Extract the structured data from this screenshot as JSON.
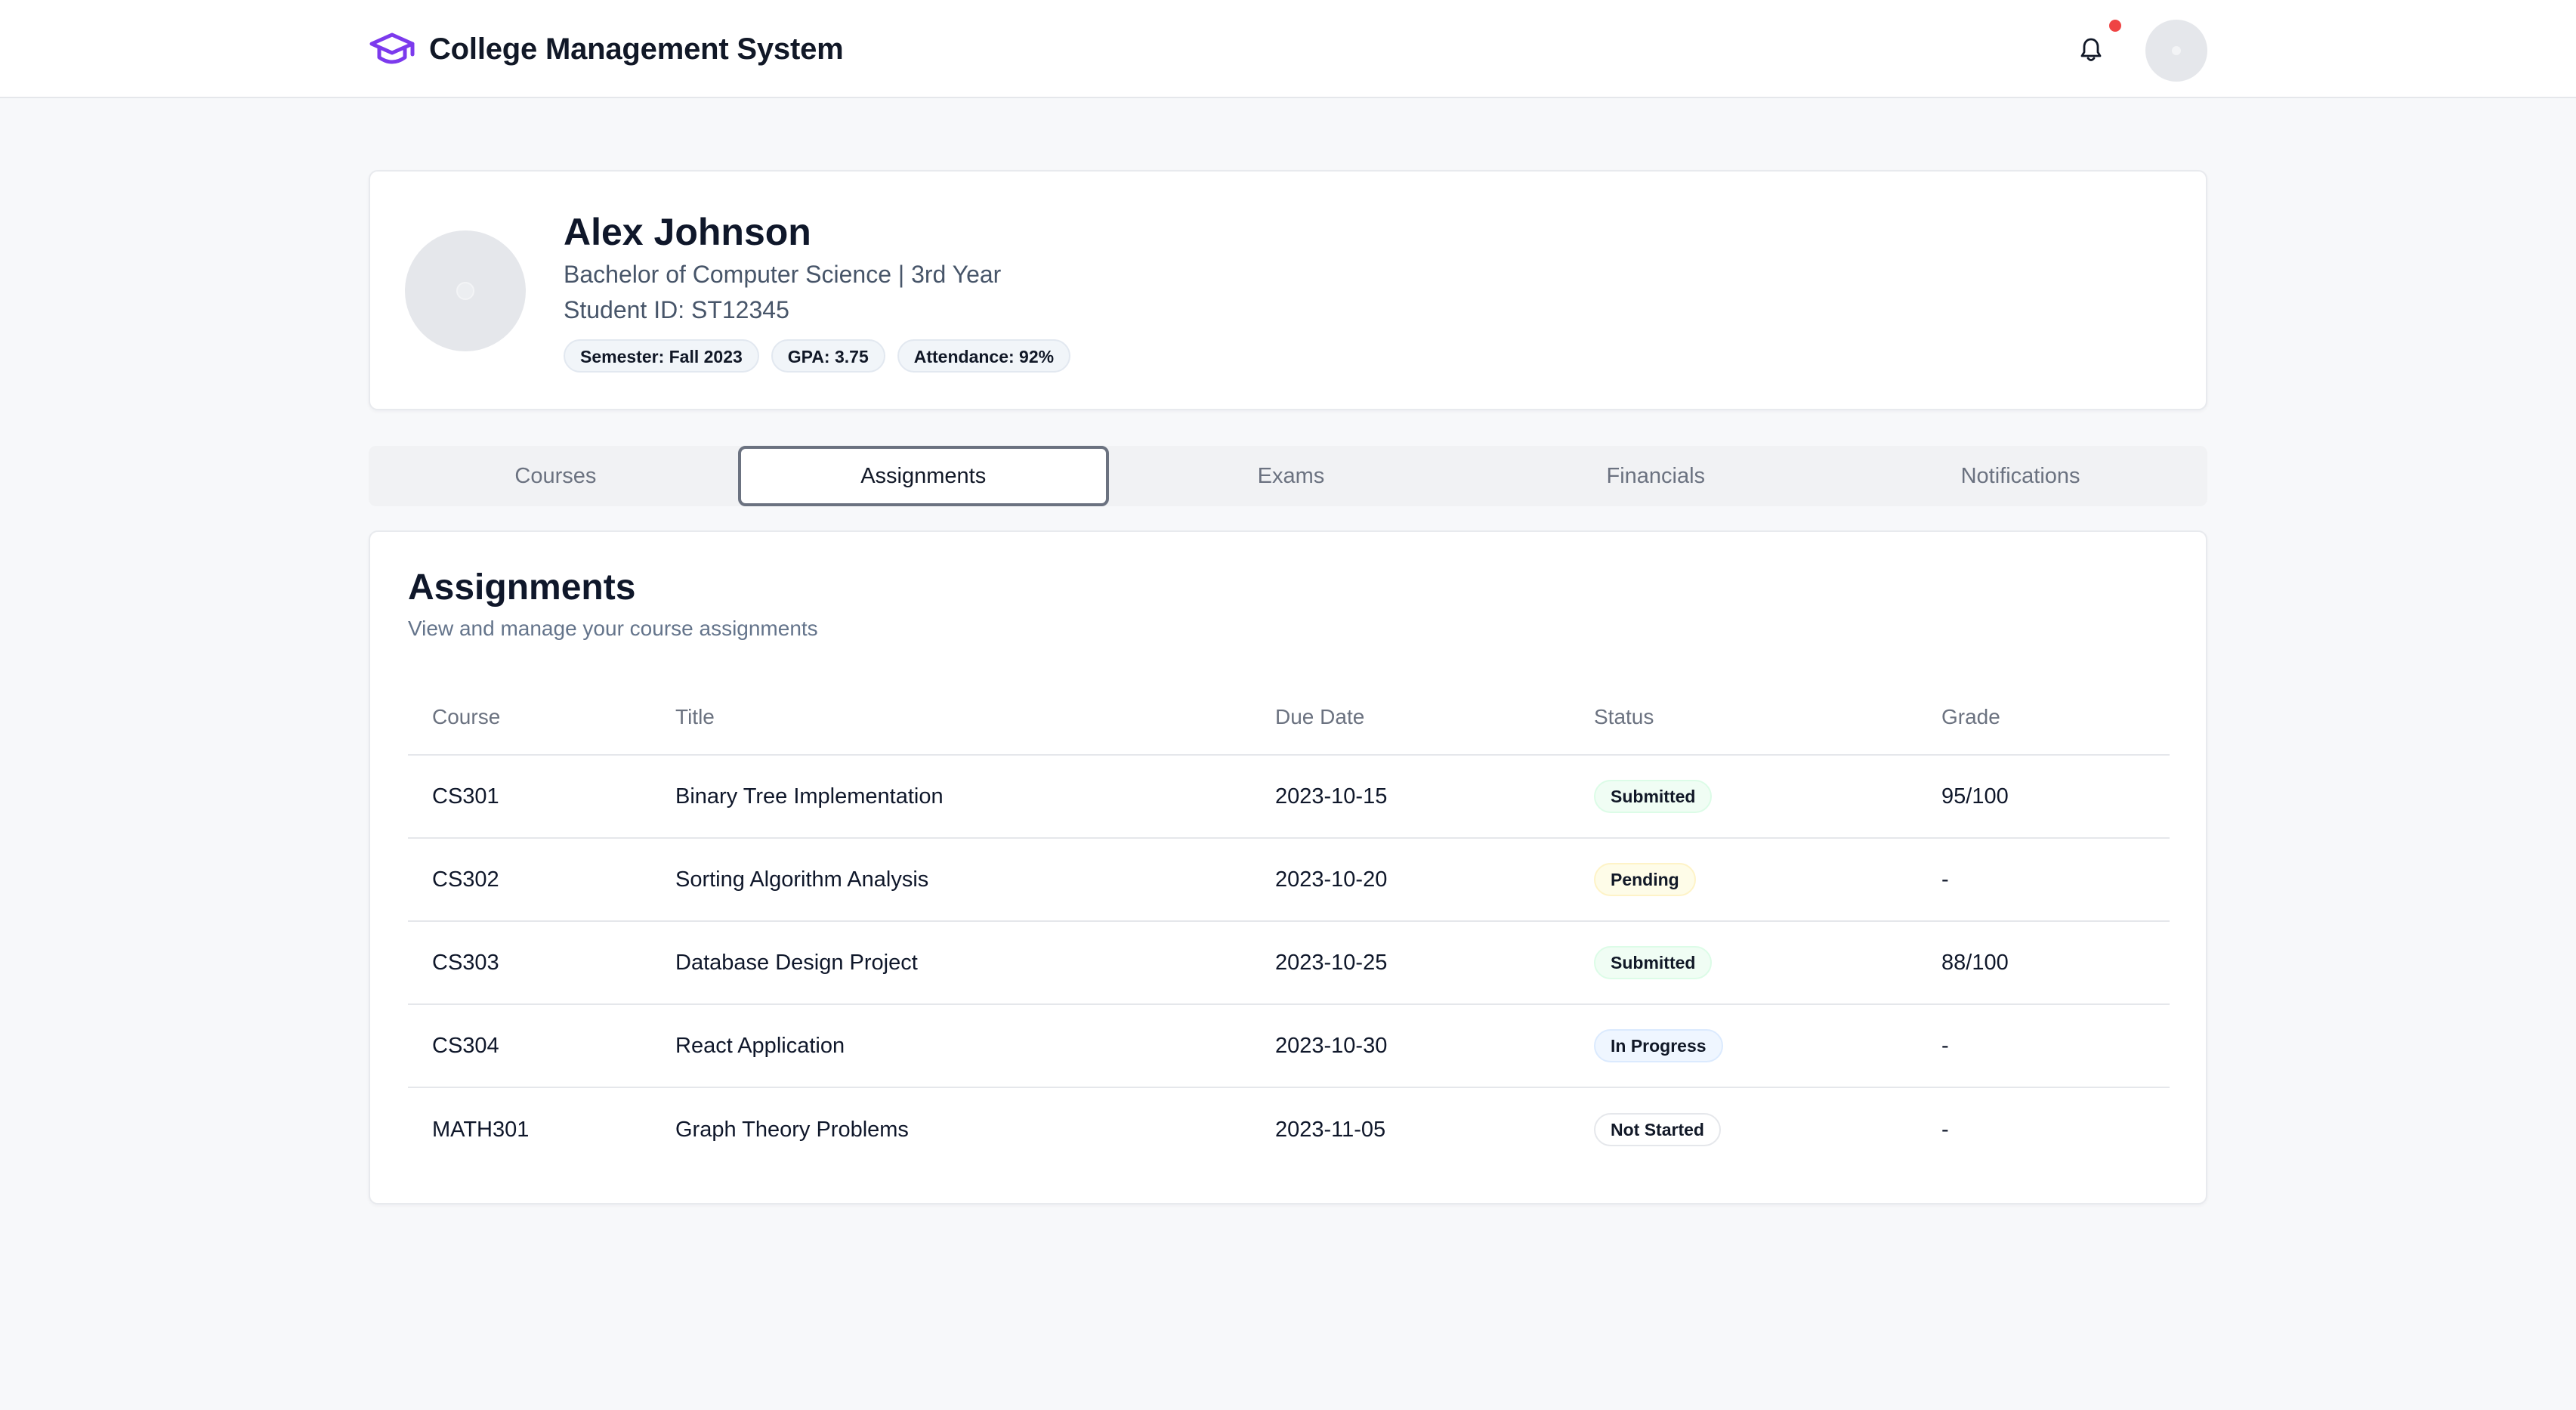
{
  "app": {
    "title": "College Management System",
    "brand_icon": "graduation-cap-icon",
    "accent_color": "#7c3aed",
    "notification_dot_color": "#ef4444"
  },
  "profile": {
    "name": "Alex Johnson",
    "program": "Bachelor of Computer Science | 3rd Year",
    "student_id": "Student ID: ST12345",
    "badges": [
      "Semester: Fall 2023",
      "GPA: 3.75",
      "Attendance: 92%"
    ]
  },
  "tabs": [
    {
      "label": "Courses",
      "active": false
    },
    {
      "label": "Assignments",
      "active": true
    },
    {
      "label": "Exams",
      "active": false
    },
    {
      "label": "Financials",
      "active": false
    },
    {
      "label": "Notifications",
      "active": false
    }
  ],
  "assignments": {
    "title": "Assignments",
    "subtitle": "View and manage your course assignments",
    "columns": [
      "Course",
      "Title",
      "Due Date",
      "Status",
      "Grade"
    ],
    "rows": [
      {
        "course": "CS301",
        "title": "Binary Tree Implementation",
        "due": "2023-10-15",
        "status": "Submitted",
        "grade": "95/100"
      },
      {
        "course": "CS302",
        "title": "Sorting Algorithm Analysis",
        "due": "2023-10-20",
        "status": "Pending",
        "grade": "-"
      },
      {
        "course": "CS303",
        "title": "Database Design Project",
        "due": "2023-10-25",
        "status": "Submitted",
        "grade": "88/100"
      },
      {
        "course": "CS304",
        "title": "React Application",
        "due": "2023-10-30",
        "status": "In Progress",
        "grade": "-"
      },
      {
        "course": "MATH301",
        "title": "Graph Theory Problems",
        "due": "2023-11-05",
        "status": "Not Started",
        "grade": "-"
      }
    ]
  }
}
